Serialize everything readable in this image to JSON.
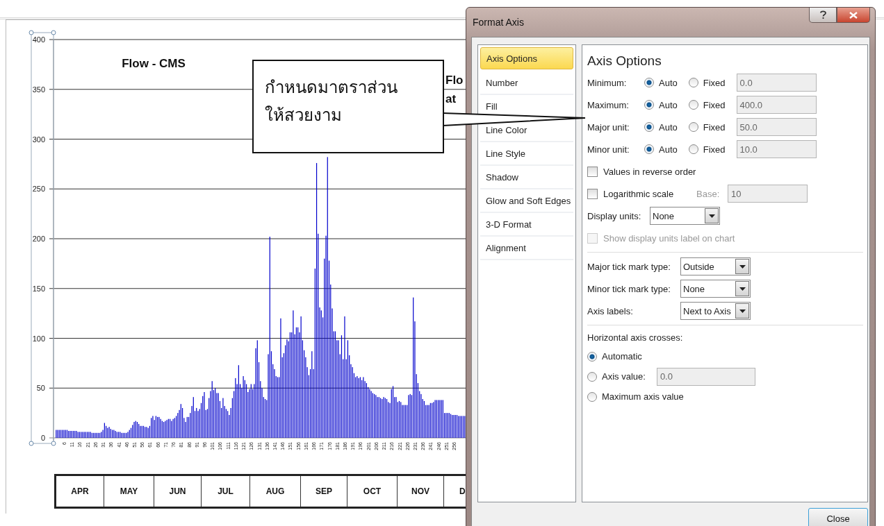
{
  "chart": {
    "second_title_lines": [
      "Flo",
      "at"
    ],
    "chart_data": {
      "type": "bar",
      "title": "Flow - CMS",
      "grid": true,
      "xlim": [
        0,
        264
      ],
      "ylim": [
        0,
        400
      ],
      "yticks": [
        0,
        50,
        100,
        150,
        200,
        250,
        300,
        350,
        400
      ],
      "x": [
        1,
        2,
        3,
        4,
        5,
        6,
        7,
        8,
        9,
        10,
        11,
        12,
        13,
        14,
        15,
        16,
        17,
        18,
        19,
        20,
        21,
        22,
        23,
        24,
        25,
        26,
        27,
        28,
        29,
        30,
        31,
        32,
        33,
        34,
        35,
        36,
        37,
        38,
        39,
        40,
        41,
        42,
        43,
        44,
        45,
        46,
        47,
        48,
        49,
        50,
        51,
        52,
        53,
        54,
        55,
        56,
        57,
        58,
        59,
        60,
        61,
        62,
        63,
        64,
        65,
        66,
        67,
        68,
        69,
        70,
        71,
        72,
        73,
        74,
        75,
        76,
        77,
        78,
        79,
        80,
        81,
        82,
        83,
        84,
        85,
        86,
        87,
        88,
        89,
        90,
        91,
        92,
        93,
        94,
        95,
        96,
        97,
        98,
        99,
        100,
        101,
        102,
        103,
        104,
        105,
        106,
        107,
        108,
        109,
        110,
        111,
        112,
        113,
        114,
        115,
        116,
        117,
        118,
        119,
        120,
        121,
        122,
        123,
        124,
        125,
        126,
        127,
        128,
        129,
        130,
        131,
        132,
        133,
        134,
        135,
        136,
        137,
        138,
        139,
        140,
        141,
        142,
        143,
        144,
        145,
        146,
        147,
        148,
        149,
        150,
        151,
        152,
        153,
        154,
        155,
        156,
        157,
        158,
        159,
        160,
        161,
        162,
        163,
        164,
        165,
        166,
        167,
        168,
        169,
        170,
        171,
        172,
        173,
        174,
        175,
        176,
        177,
        178,
        179,
        180,
        181,
        182,
        183,
        184,
        185,
        186,
        187,
        188,
        189,
        190,
        191,
        192,
        193,
        194,
        195,
        196,
        197,
        198,
        199,
        200,
        201,
        202,
        203,
        204,
        205,
        206,
        207,
        208,
        209,
        210,
        211,
        212,
        213,
        214,
        215,
        216,
        217,
        218,
        219,
        220,
        221,
        222,
        223,
        224,
        225,
        226,
        227,
        228,
        229,
        230,
        231,
        232,
        233,
        234,
        235,
        236,
        237,
        238,
        239,
        240,
        241,
        242,
        243,
        244,
        245,
        246,
        247,
        248,
        249,
        250,
        251,
        252,
        253,
        254,
        255,
        256,
        257,
        258,
        259,
        260,
        261,
        262,
        263
      ],
      "xticks": [
        6,
        11,
        16,
        21,
        26,
        31,
        36,
        41,
        46,
        51,
        56,
        61,
        66,
        71,
        76,
        81,
        86,
        91,
        96,
        101,
        106,
        111,
        116,
        121,
        126,
        131,
        136,
        141,
        146,
        151,
        156,
        161,
        166,
        171,
        176,
        181,
        186,
        191,
        196,
        201,
        206,
        211,
        216,
        221,
        226,
        231,
        236,
        241,
        246,
        251,
        256
      ],
      "series": [
        {
          "color": "#0000cc",
          "values": [
            8,
            8,
            8,
            8,
            8,
            8,
            8,
            8,
            7,
            7,
            7,
            7,
            7,
            7,
            6,
            6,
            6,
            6,
            6,
            6,
            6,
            6,
            6,
            5,
            5,
            5,
            5,
            5,
            5,
            6,
            8,
            15,
            12,
            10,
            11,
            9,
            8,
            8,
            7,
            6,
            6,
            6,
            5,
            5,
            5,
            5,
            6,
            8,
            10,
            13,
            16,
            17,
            16,
            14,
            12,
            12,
            12,
            11,
            11,
            10,
            12,
            20,
            22,
            18,
            22,
            21,
            21,
            19,
            17,
            16,
            17,
            18,
            19,
            19,
            17,
            19,
            20,
            22,
            25,
            28,
            34,
            30,
            20,
            16,
            21,
            21,
            25,
            32,
            41,
            27,
            30,
            27,
            29,
            35,
            42,
            46,
            28,
            29,
            40,
            47,
            57,
            48,
            50,
            45,
            45,
            37,
            30,
            40,
            32,
            29,
            27,
            23,
            30,
            40,
            47,
            60,
            54,
            73,
            54,
            50,
            62,
            58,
            54,
            46,
            49,
            54,
            49,
            54,
            90,
            98,
            76,
            57,
            50,
            41,
            39,
            38,
            84,
            202,
            87,
            74,
            69,
            62,
            61,
            61,
            120,
            81,
            85,
            93,
            99,
            97,
            106,
            106,
            128,
            104,
            111,
            111,
            106,
            122,
            98,
            88,
            81,
            71,
            63,
            69,
            87,
            69,
            170,
            276,
            205,
            131,
            128,
            121,
            180,
            203,
            282,
            178,
            154,
            130,
            107,
            107,
            98,
            98,
            84,
            103,
            79,
            122,
            79,
            98,
            83,
            74,
            71,
            65,
            61,
            62,
            60,
            61,
            58,
            61,
            57,
            55,
            51,
            49,
            47,
            45,
            44,
            43,
            41,
            41,
            40,
            39,
            41,
            40,
            39,
            36,
            35,
            49,
            52,
            41,
            41,
            36,
            37,
            36,
            33,
            33,
            33,
            33,
            43,
            44,
            43,
            141,
            117,
            64,
            55,
            47,
            44,
            39,
            37,
            33,
            33,
            33,
            35,
            35,
            36,
            38,
            38,
            38,
            38,
            38,
            38,
            25,
            25,
            25,
            25,
            24,
            23,
            23,
            23,
            23,
            22,
            22,
            22,
            22,
            22
          ]
        }
      ]
    },
    "months": [
      "APR",
      "MAY",
      "JUN",
      "JUL",
      "AUG",
      "SEP",
      "OCT",
      "NOV",
      "D"
    ]
  },
  "callout": {
    "lines": [
      "กำหนดมาตราส่วน",
      "ให้สวยงาม"
    ]
  },
  "dialog": {
    "title": "Format Axis",
    "nav": [
      {
        "label": "Axis Options",
        "selected": true
      },
      {
        "label": "Number",
        "selected": false
      },
      {
        "label": "Fill",
        "selected": false
      },
      {
        "label": "Line Color",
        "selected": false
      },
      {
        "label": "Line Style",
        "selected": false
      },
      {
        "label": "Shadow",
        "selected": false
      },
      {
        "label": "Glow and Soft Edges",
        "selected": false
      },
      {
        "label": "3-D Format",
        "selected": false
      },
      {
        "label": "Alignment",
        "selected": false
      }
    ],
    "heading": "Axis Options",
    "bound_rows": [
      {
        "label": "Minimum:",
        "options": [
          {
            "label": "Auto",
            "selected": true
          },
          {
            "label": "Fixed",
            "selected": false
          }
        ],
        "value": "0.0",
        "disabled": true
      },
      {
        "label": "Maximum:",
        "options": [
          {
            "label": "Auto",
            "selected": true
          },
          {
            "label": "Fixed",
            "selected": false
          }
        ],
        "value": "400.0",
        "disabled": true
      },
      {
        "label": "Major unit:",
        "options": [
          {
            "label": "Auto",
            "selected": true
          },
          {
            "label": "Fixed",
            "selected": false
          }
        ],
        "value": "50.0",
        "disabled": true
      },
      {
        "label": "Minor unit:",
        "options": [
          {
            "label": "Auto",
            "selected": true
          },
          {
            "label": "Fixed",
            "selected": false
          }
        ],
        "value": "10.0",
        "disabled": true
      }
    ],
    "reverse": {
      "label": "Values in reverse order",
      "checked": false
    },
    "log": {
      "label": "Logarithmic scale",
      "checked": false,
      "base_label": "Base:",
      "base_value": "10",
      "disabled": true
    },
    "display_units": {
      "label": "Display units:",
      "value": "None"
    },
    "show_units_label": {
      "label": "Show display units label on chart",
      "checked": false,
      "disabled": true
    },
    "tick_rows": [
      {
        "label": "Major tick mark type:",
        "value": "Outside"
      },
      {
        "label": "Minor tick mark type:",
        "value": "None"
      },
      {
        "label": "Axis labels:",
        "value": "Next to Axis"
      }
    ],
    "crosses": {
      "label": "Horizontal axis crosses:",
      "options": [
        {
          "kind": "plain",
          "label": "Automatic",
          "selected": true
        },
        {
          "kind": "value",
          "label": "Axis value:",
          "selected": false,
          "value": "0.0",
          "disabled": true
        },
        {
          "kind": "plain",
          "label": "Maximum axis value",
          "selected": false
        }
      ]
    },
    "buttons": [
      "Close"
    ]
  }
}
